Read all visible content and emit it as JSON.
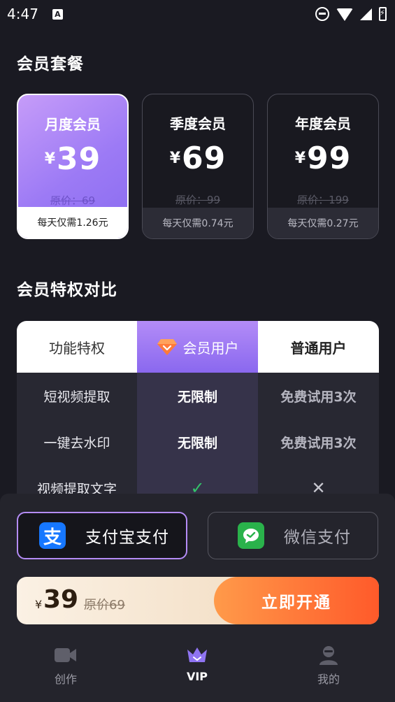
{
  "status_bar": {
    "time": "4:47",
    "notification_glyph": "A"
  },
  "plans_section": {
    "title": "会员套餐",
    "plans": [
      {
        "name": "月度会员",
        "currency": "¥",
        "price": "39",
        "original": "原价：69",
        "daily": "每天仅需1.26元",
        "selected": true
      },
      {
        "name": "季度会员",
        "currency": "¥",
        "price": "69",
        "original": "原价：99",
        "daily": "每天仅需0.74元",
        "selected": false
      },
      {
        "name": "年度会员",
        "currency": "¥",
        "price": "99",
        "original": "原价：199",
        "daily": "每天仅需0.27元",
        "selected": false
      }
    ]
  },
  "compare_section": {
    "title": "会员特权对比",
    "headers": {
      "feature": "功能特权",
      "vip": "会员用户",
      "normal": "普通用户"
    },
    "rows": [
      {
        "feature": "短视频提取",
        "vip": "无限制",
        "normal": "免费试用3次"
      },
      {
        "feature": "一键去水印",
        "vip": "无限制",
        "normal": "免费试用3次"
      },
      {
        "feature": "视频提取文字",
        "vip": "✓",
        "normal": "✕"
      }
    ]
  },
  "payment": {
    "options": [
      {
        "label": "支付宝支付",
        "icon": "alipay-icon",
        "glyph": "支",
        "selected": true
      },
      {
        "label": "微信支付",
        "icon": "wechat-pay-icon",
        "selected": false
      }
    ]
  },
  "purchase": {
    "currency": "¥",
    "price": "39",
    "original": "原价69",
    "button": "立即开通"
  },
  "tabs": [
    {
      "label": "创作",
      "icon": "video-camera-icon",
      "active": false
    },
    {
      "label": "VIP",
      "icon": "crown-icon",
      "active": true
    },
    {
      "label": "我的",
      "icon": "profile-icon",
      "active": false
    }
  ],
  "colors": {
    "background": "#1a1a22",
    "accent_purple": "#9c7af5",
    "buy_orange": "#ff5a2a",
    "alipay_blue": "#1677ff",
    "wechat_green": "#2ab24b"
  }
}
